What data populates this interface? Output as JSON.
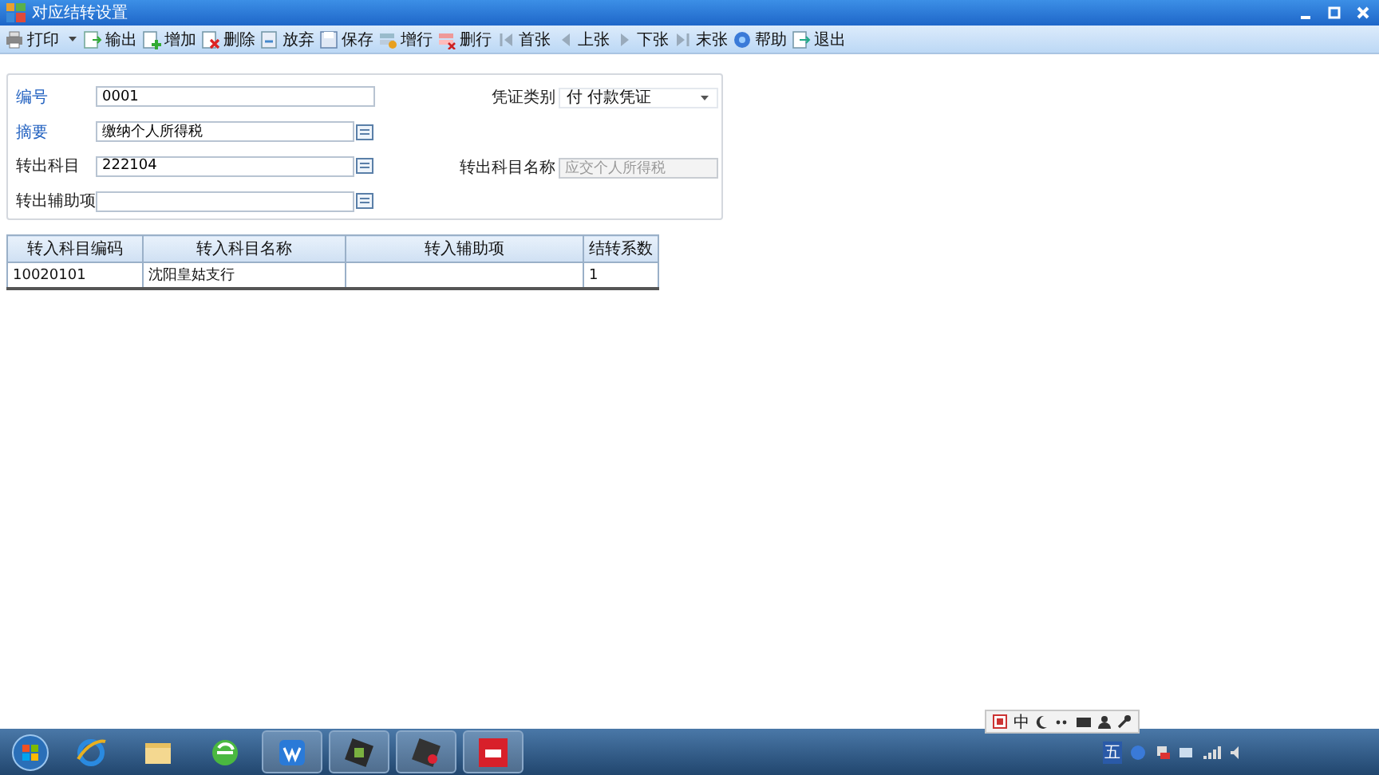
{
  "window": {
    "title": "对应结转设置"
  },
  "toolbar": [
    {
      "label": "打印",
      "has_menu": true
    },
    {
      "label": "输出",
      "has_menu": false
    },
    {
      "label": "增加",
      "has_menu": false
    },
    {
      "label": "删除",
      "has_menu": false
    },
    {
      "label": "放弃",
      "has_menu": false
    },
    {
      "label": "保存",
      "has_menu": false
    },
    {
      "label": "增行",
      "has_menu": false
    },
    {
      "label": "删行",
      "has_menu": false
    },
    {
      "label": "首张",
      "has_menu": false
    },
    {
      "label": "上张",
      "has_menu": false
    },
    {
      "label": "下张",
      "has_menu": false
    },
    {
      "label": "末张",
      "has_menu": false
    },
    {
      "label": "帮助",
      "has_menu": false
    },
    {
      "label": "退出",
      "has_menu": false
    }
  ],
  "form": {
    "left": [
      {
        "label": "编号",
        "value": "0001",
        "required": true,
        "lookup": false
      },
      {
        "label": "摘要",
        "value": "缴纳个人所得税",
        "required": true,
        "lookup": true
      },
      {
        "label": "转出科目",
        "value": "222104",
        "required": false,
        "lookup": true
      },
      {
        "label": "转出辅助项",
        "required": false,
        "lookup": true
      }
    ],
    "right": [
      {
        "label": "凭证类别",
        "value": "付 付款凭证",
        "kind": "select"
      },
      {
        "kind": "blank"
      },
      {
        "label": "转出科目名称",
        "value": "应交个人所得税",
        "kind": "text",
        "disabled": true
      }
    ]
  },
  "table": {
    "columns": [
      "转入科目编码",
      "转入科目名称",
      "转入辅助项",
      "结转系数"
    ],
    "rows": [
      [
        "10020101",
        "沈阳皇姑支行",
        "",
        "1"
      ]
    ]
  },
  "ime_bar": {
    "mode": "中"
  },
  "taskbar": {
    "apps": [
      {
        "running": false
      },
      {
        "running": false
      },
      {
        "running": false
      },
      {
        "running": true
      },
      {
        "running": true
      },
      {
        "running": true
      },
      {
        "running": true
      }
    ],
    "tray_ime": "五"
  }
}
